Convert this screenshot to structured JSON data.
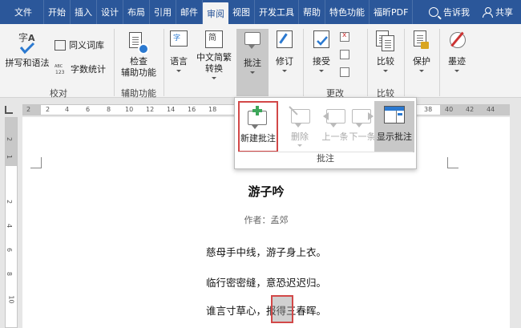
{
  "tabs": [
    "文件",
    "开始",
    "插入",
    "设计",
    "布局",
    "引用",
    "邮件",
    "审阅",
    "视图",
    "开发工具",
    "帮助",
    "特色功能",
    "福昕PDF"
  ],
  "active_tab": "审阅",
  "tell_me": "告诉我",
  "share": "共享",
  "ribbon": {
    "proofing": {
      "spelling": "拼写和语法",
      "thesaurus": "同义词库",
      "wordcount": "字数统计",
      "label": "校对"
    },
    "accessibility": {
      "check1": "检查",
      "check2": "辅助功能",
      "label": "辅助功能"
    },
    "language": {
      "lang": "语言",
      "convert1": "中文简繁",
      "convert2": "转换"
    },
    "comments": {
      "comment": "批注"
    },
    "tracking": {
      "track": "修订"
    },
    "changes": {
      "accept": "接受",
      "label": "更改"
    },
    "compare": {
      "compare": "比较",
      "label": "比较"
    },
    "protect": {
      "protect": "保护"
    },
    "ink": {
      "ink": "墨迹"
    }
  },
  "flyout": {
    "new_comment": "新建批注",
    "delete": "删除",
    "previous": "上一条",
    "next": "下一条",
    "show_comments": "显示批注",
    "label": "批注"
  },
  "ruler": {
    "h_ticks": [
      "2",
      "2",
      "4",
      "6",
      "8",
      "10",
      "12",
      "14",
      "16",
      "18",
      "38",
      "40",
      "42",
      "44"
    ],
    "v_ticks": [
      "2",
      "1",
      "2",
      "4",
      "6",
      "8",
      "10"
    ]
  },
  "document": {
    "title": "游子吟",
    "author": "作者：孟郊",
    "lines": [
      "慈母手中线，游子身上衣。",
      "临行密密缝，意恐迟迟归。",
      "谁言寸草心，报得三春晖。"
    ]
  }
}
